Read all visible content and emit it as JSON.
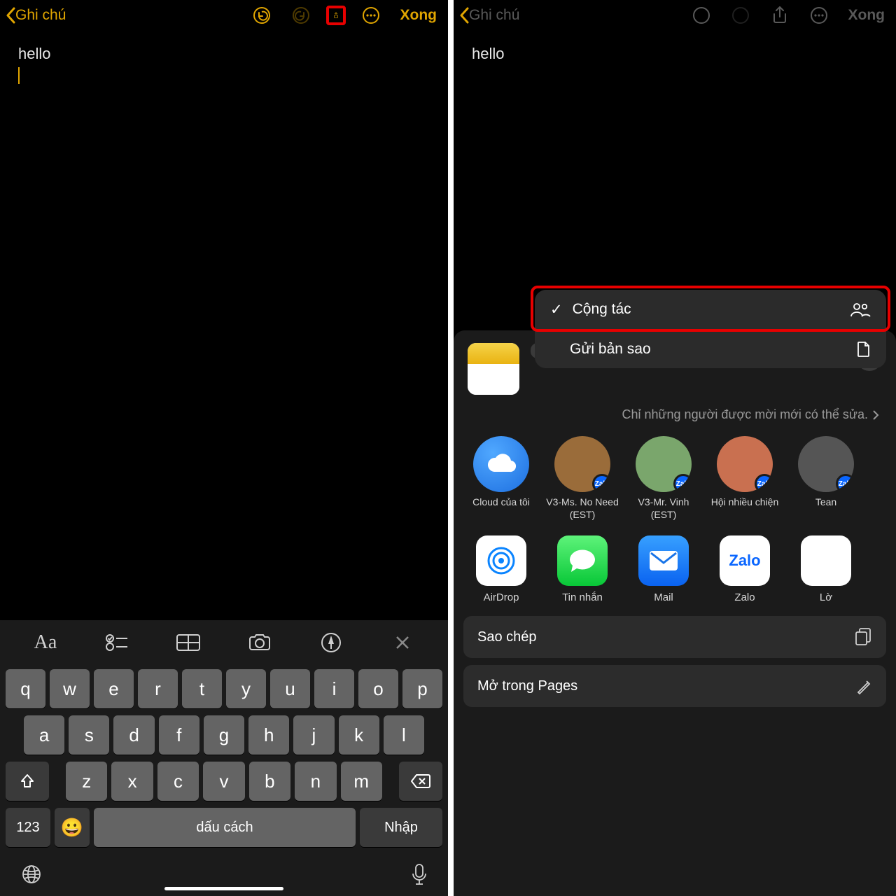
{
  "nav": {
    "back": "Ghi chú",
    "done": "Xong"
  },
  "note": {
    "text": "hello"
  },
  "keyboard": {
    "format_close": "×",
    "row1": [
      "q",
      "w",
      "e",
      "r",
      "t",
      "y",
      "u",
      "i",
      "o",
      "p"
    ],
    "row2": [
      "a",
      "s",
      "d",
      "f",
      "g",
      "h",
      "j",
      "k",
      "l"
    ],
    "row3": [
      "z",
      "x",
      "c",
      "v",
      "b",
      "n",
      "m"
    ],
    "num": "123",
    "space": "dấu cách",
    "enter": "Nhập"
  },
  "popover": {
    "collaborate": "Cộng tác",
    "send_copy": "Gửi bản sao"
  },
  "sheet": {
    "chip_label": "Cộng tác",
    "permission": "Chỉ những người được mời mới có thể sửa.",
    "contacts": [
      {
        "label": "Cloud của tôi"
      },
      {
        "label": "V3-Ms. No Need (EST)"
      },
      {
        "label": "V3-Mr. Vinh (EST)"
      },
      {
        "label": "Hội nhiều chiện"
      },
      {
        "label": "Tean"
      }
    ],
    "contact_badge": "Zalo",
    "apps": [
      {
        "label": "AirDrop"
      },
      {
        "label": "Tin nhắn"
      },
      {
        "label": "Mail"
      },
      {
        "label": "Zalo"
      },
      {
        "label": "Lờ"
      }
    ],
    "actions": [
      {
        "label": "Sao chép"
      },
      {
        "label": "Mở trong Pages"
      }
    ]
  }
}
